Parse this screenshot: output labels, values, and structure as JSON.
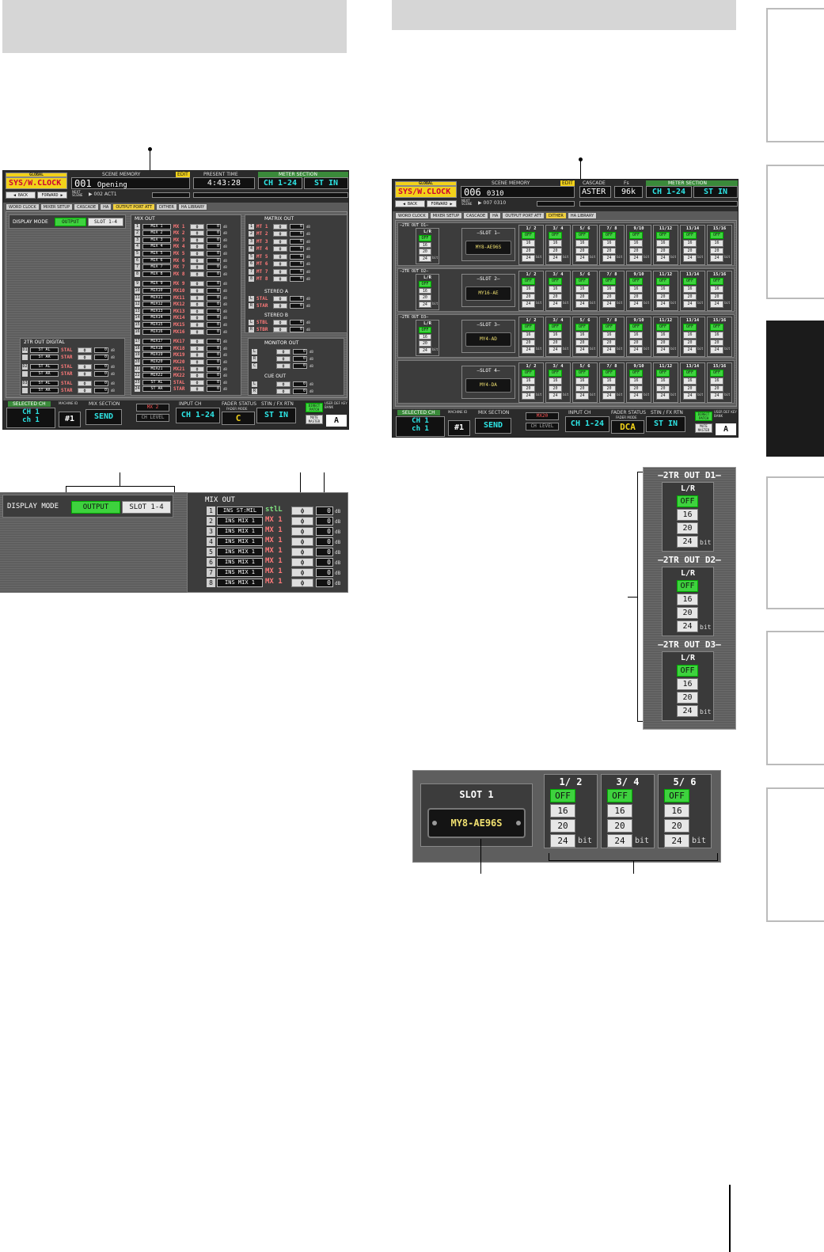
{
  "screen1": {
    "top": {
      "global": "GLOBAL",
      "sys": "SYS/W.CLOCK",
      "scene_memory_label": "SCENE MEMORY",
      "edit": "EDIT",
      "scene_num": "001",
      "scene_name": "Opening",
      "back": "◀ BACK",
      "forward": "FORWARD ▶",
      "next_scene_label": "NEXT SCENE",
      "next_scene": "▶ 002 ACT1",
      "present_time_label": "PRESENT TIME",
      "time": "4:43:28",
      "meter_label": "METER SECTION",
      "meter_a": "CH 1-24",
      "meter_b": "ST IN"
    },
    "tabs": [
      "WORD CLOCK",
      "MIXER SETUP",
      "CASCADE",
      "HA",
      "OUTPUT PORT ATT",
      "DITHER",
      "HA LIBRARY"
    ],
    "display_mode_label": "DISPLAY MODE",
    "mode_output": "OUTPUT",
    "mode_slot": "SLOT 1-4",
    "mix_out_label": "MIX OUT",
    "mix_rows": [
      {
        "n": "1",
        "name": "MIX 1",
        "port": "MX 1"
      },
      {
        "n": "2",
        "name": "MIX 2",
        "port": "MX 2"
      },
      {
        "n": "3",
        "name": "MIX 3",
        "port": "MX 3"
      },
      {
        "n": "4",
        "name": "MIX 4",
        "port": "MX 4"
      },
      {
        "n": "5",
        "name": "MIX 5",
        "port": "MX 5"
      },
      {
        "n": "6",
        "name": "MIX 6",
        "port": "MX 6"
      },
      {
        "n": "7",
        "name": "MIX 7",
        "port": "MX 7"
      },
      {
        "n": "8",
        "name": "MIX 8",
        "port": "MX 8"
      },
      {
        "n": "9",
        "name": "MIX 9",
        "port": "MX 9"
      },
      {
        "n": "10",
        "name": "MIX10",
        "port": "MX10"
      },
      {
        "n": "11",
        "name": "MIX11",
        "port": "MX11"
      },
      {
        "n": "12",
        "name": "MIX12",
        "port": "MX12"
      },
      {
        "n": "13",
        "name": "MIX13",
        "port": "MX13"
      },
      {
        "n": "14",
        "name": "MIX14",
        "port": "MX14"
      },
      {
        "n": "15",
        "name": "MIX15",
        "port": "MX15"
      },
      {
        "n": "16",
        "name": "MIX16",
        "port": "MX16"
      },
      {
        "n": "17",
        "name": "MIX17",
        "port": "MX17"
      },
      {
        "n": "18",
        "name": "MIX18",
        "port": "MX18"
      },
      {
        "n": "19",
        "name": "MIX19",
        "port": "MX19"
      },
      {
        "n": "20",
        "name": "MIX20",
        "port": "MX20"
      },
      {
        "n": "21",
        "name": "MIX21",
        "port": "MX21"
      },
      {
        "n": "22",
        "name": "MIX22",
        "port": "MX22"
      },
      {
        "n": "23",
        "name": "ST AL",
        "port": "STAL"
      },
      {
        "n": "24",
        "name": "ST AR",
        "port": "STAR"
      }
    ],
    "matrix_out_label": "MATRIX OUT",
    "matrix_rows": [
      {
        "n": "1",
        "port": "MT 1"
      },
      {
        "n": "2",
        "port": "MT 2"
      },
      {
        "n": "3",
        "port": "MT 3"
      },
      {
        "n": "4",
        "port": "MT 4"
      },
      {
        "n": "5",
        "port": "MT 5"
      },
      {
        "n": "6",
        "port": "MT 6"
      },
      {
        "n": "7",
        "port": "MT 7"
      },
      {
        "n": "8",
        "port": "MT 8"
      }
    ],
    "stereo_a_label": "STEREO A",
    "stereo_a": [
      {
        "n": "L",
        "port": "STAL"
      },
      {
        "n": "R",
        "port": "STAR"
      }
    ],
    "stereo_b_label": "STEREO B",
    "stereo_b": [
      {
        "n": "L",
        "port": "STBL"
      },
      {
        "n": "R",
        "port": "STBR"
      }
    ],
    "monitor_out_label": "MONITOR OUT",
    "monitor_rows": [
      {
        "n": "L"
      },
      {
        "n": "R"
      },
      {
        "n": "C"
      }
    ],
    "cue_out_label": "CUE OUT",
    "cue_rows": [
      {
        "n": "L"
      },
      {
        "n": "R"
      }
    ],
    "twotr_label": "2TR OUT DIGITAL",
    "twotr_rows": [
      {
        "n": "D1",
        "name": "ST AL",
        "port": "STAL"
      },
      {
        "n": "",
        "name": "ST AR",
        "port": "STAR"
      },
      {
        "n": "D2",
        "name": "ST AL",
        "port": "STAL"
      },
      {
        "n": "",
        "name": "ST AR",
        "port": "STAR"
      },
      {
        "n": "D3",
        "name": "ST AL",
        "port": "STAL"
      },
      {
        "n": "",
        "name": "ST AR",
        "port": "STAR"
      }
    ],
    "att_value": "0",
    "phase_symbol": "ϕ",
    "db_unit": "dB",
    "bottom": {
      "selected_ch_label": "SELECTED CH",
      "ch_a": "CH 1",
      "ch_b": "ch 1",
      "machine_id_label": "MACHINE ID",
      "machine_id": "#1",
      "mix_section_label": "MIX SECTION",
      "send": "SEND",
      "mx_label": "MX 2",
      "ch_level": "CH LEVEL",
      "input_ch_label": "INPUT CH",
      "input_ch": "CH 1-24",
      "fader_status_label": "FADER STATUS",
      "fader_mode_label": "FADER MODE",
      "fader_status": "C",
      "stin_label": "STIN / FX RTN",
      "stin": "ST IN",
      "direct_label": "DIRECT PATCH",
      "mute_master": "MUTE MASTER",
      "user_def_label": "USER DEF KEY BANK",
      "bank": "A"
    }
  },
  "zoom1": {
    "display_mode_label": "DISPLAY MODE",
    "mode_output": "OUTPUT",
    "mode_slot": "SLOT 1-4",
    "mix_out_label": "MIX OUT",
    "rows": [
      {
        "n": "1",
        "name": "INS ST:MIL",
        "port": "stlL"
      },
      {
        "n": "2",
        "name": "INS MIX 1",
        "port": "MX 1"
      },
      {
        "n": "3",
        "name": "INS MIX 1",
        "port": "MX 1"
      },
      {
        "n": "4",
        "name": "INS MIX 1",
        "port": "MX 1"
      },
      {
        "n": "5",
        "name": "INS MIX 1",
        "port": "MX 1"
      },
      {
        "n": "6",
        "name": "INS MIX 1",
        "port": "MX 1"
      },
      {
        "n": "7",
        "name": "INS MIX 1",
        "port": "MX 1"
      },
      {
        "n": "8",
        "name": "INS MIX 1",
        "port": "MX 1"
      }
    ],
    "att_value": "0",
    "phase_symbol": "ϕ",
    "db_unit": "dB"
  },
  "screen2": {
    "top": {
      "global": "GLOBAL",
      "sys": "SYS/W.CLOCK",
      "scene_memory_label": "SCENE MEMORY",
      "edit": "EDIT",
      "scene_num": "006",
      "scene_name": "0310",
      "back": "◀ BACK",
      "forward": "FORWARD ▶",
      "next_scene_label": "NEXT SCENE",
      "next_scene": "▶ 007 0310",
      "cascade_label": "CASCADE",
      "cascade": "ASTER",
      "fs_label": "Fs",
      "fs": "96k",
      "meter_label": "METER SECTION",
      "meter_a": "CH 1-24",
      "meter_b": "ST IN"
    },
    "tabs": [
      "WORD CLOCK",
      "MIXER SETUP",
      "CASCADE",
      "HA",
      "OUTPUT PORT ATT",
      "DITHER",
      "HA LIBRARY"
    ],
    "outs": [
      {
        "label": "2TR OUT D1"
      },
      {
        "label": "2TR OUT D2"
      },
      {
        "label": "2TR OUT D3"
      }
    ],
    "lr_label": "L/R",
    "slots": [
      {
        "label": "SLOT 1",
        "card": "MY8-AE96S"
      },
      {
        "label": "SLOT 2",
        "card": "MY16-AE"
      },
      {
        "label": "SLOT 3",
        "card": "MY4-AD"
      },
      {
        "label": "SLOT 4",
        "card": "MY4-DA"
      }
    ],
    "pairs": [
      "1/ 2",
      "3/ 4",
      "5/ 6",
      "7/ 8",
      "9/10",
      "11/12",
      "13/14",
      "15/16"
    ],
    "bits": [
      "OFF",
      "16",
      "20",
      "24"
    ],
    "bit_unit": "bit",
    "bottom": {
      "selected_ch_label": "SELECTED CH",
      "ch_a": "CH 1",
      "ch_b": "ch 1",
      "machine_id_label": "MACHINE ID",
      "machine_id": "#1",
      "mix_section_label": "MIX SECTION",
      "send": "SEND",
      "mx_label": "MX20",
      "ch_level": "CH LEVEL",
      "input_ch_label": "INPUT CH",
      "input_ch": "CH 1-24",
      "fader_status_label": "FADER STATUS",
      "fader_mode_label": "FADER MODE",
      "fader_status": "DCA",
      "stin_label": "STIN / FX RTN",
      "stin": "ST IN",
      "direct_label": "DIRECT PATCH",
      "mute_master": "MUTE MASTER",
      "user_def_label": "USER DEF KEY BANK",
      "bank": "A"
    }
  },
  "zoom2": {
    "outs": [
      {
        "label": "2TR OUT D1"
      },
      {
        "label": "2TR OUT D2"
      },
      {
        "label": "2TR OUT D3"
      }
    ],
    "lr_label": "L/R",
    "bits": [
      "OFF",
      "16",
      "20",
      "24"
    ],
    "bit_unit": "bit"
  },
  "zoom3": {
    "slot_label": "SLOT 1",
    "card": "MY8-AE96S",
    "pairs": [
      "1/ 2",
      "3/ 4",
      "5/ 6"
    ],
    "bits": [
      "OFF",
      "16",
      "20",
      "24"
    ],
    "bit_unit": "bit"
  }
}
